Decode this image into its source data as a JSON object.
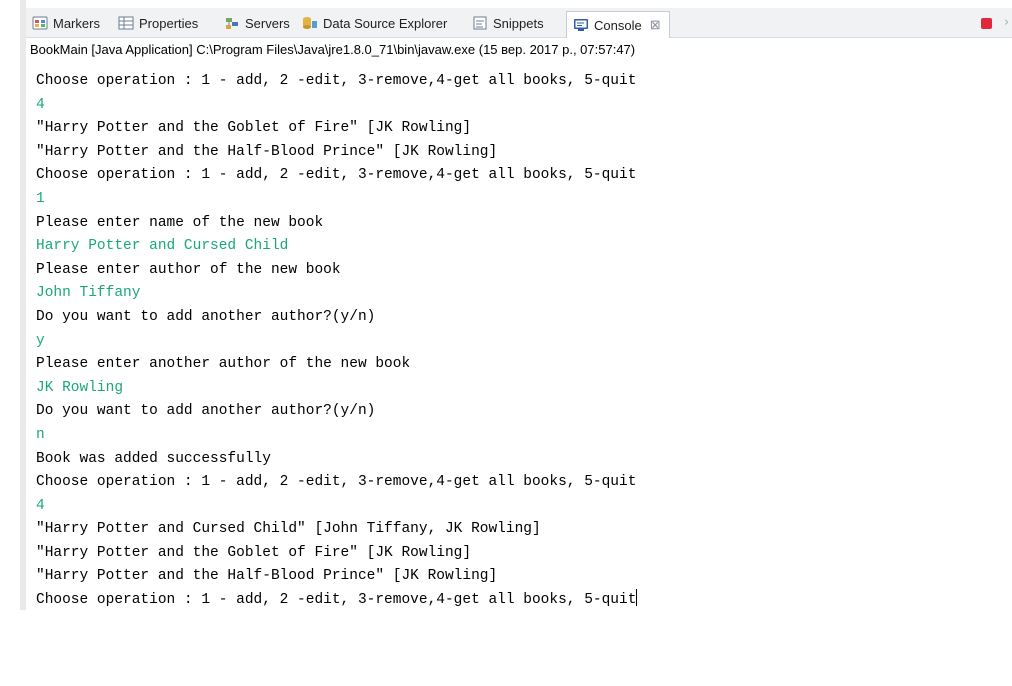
{
  "tabs": [
    {
      "label": "Markers",
      "icon": "markers-icon"
    },
    {
      "label": "Properties",
      "icon": "properties-icon"
    },
    {
      "label": "Servers",
      "icon": "servers-icon"
    },
    {
      "label": "Data Source Explorer",
      "icon": "data-source-explorer-icon"
    },
    {
      "label": "Snippets",
      "icon": "snippets-icon"
    },
    {
      "label": "Console",
      "icon": "console-icon",
      "active": true,
      "close": "⊠"
    }
  ],
  "launch_info": "BookMain [Java Application] C:\\Program Files\\Java\\jre1.8.0_71\\bin\\javaw.exe (15 вер. 2017 р., 07:57:47)",
  "colors": {
    "input_text": "#1aa87a",
    "output_text": "#000000",
    "stop_button": "#e0293a"
  },
  "console": {
    "lines": [
      {
        "text": "Choose operation : 1 - add, 2 -edit, 3-remove,4-get all books, 5-quit",
        "kind": "output"
      },
      {
        "text": "4",
        "kind": "input"
      },
      {
        "text": "\"Harry Potter and the Goblet of Fire\" [JK Rowling]",
        "kind": "output"
      },
      {
        "text": "\"Harry Potter and the Half-Blood Prince\" [JK Rowling]",
        "kind": "output"
      },
      {
        "text": "Choose operation : 1 - add, 2 -edit, 3-remove,4-get all books, 5-quit",
        "kind": "output"
      },
      {
        "text": "1",
        "kind": "input"
      },
      {
        "text": "Please enter name of the new book",
        "kind": "output"
      },
      {
        "text": "Harry Potter and Cursed Child",
        "kind": "input"
      },
      {
        "text": "Please enter author of the new book",
        "kind": "output"
      },
      {
        "text": "John Tiffany",
        "kind": "input"
      },
      {
        "text": "Do you want to add another author?(y/n)",
        "kind": "output"
      },
      {
        "text": "y",
        "kind": "input"
      },
      {
        "text": "Please enter another author of the new book",
        "kind": "output"
      },
      {
        "text": "JK Rowling",
        "kind": "input"
      },
      {
        "text": "Do you want to add another author?(y/n)",
        "kind": "output"
      },
      {
        "text": "n",
        "kind": "input"
      },
      {
        "text": "Book was added successfully",
        "kind": "output"
      },
      {
        "text": "Choose operation : 1 - add, 2 -edit, 3-remove,4-get all books, 5-quit",
        "kind": "output"
      },
      {
        "text": "4",
        "kind": "input"
      },
      {
        "text": "\"Harry Potter and Cursed Child\" [John Tiffany, JK Rowling]",
        "kind": "output"
      },
      {
        "text": "\"Harry Potter and the Goblet of Fire\" [JK Rowling]",
        "kind": "output"
      },
      {
        "text": "\"Harry Potter and the Half-Blood Prince\" [JK Rowling]",
        "kind": "output"
      },
      {
        "text": "Choose operation : 1 - add, 2 -edit, 3-remove,4-get all books, 5-quit",
        "kind": "output",
        "caret": true
      }
    ]
  }
}
